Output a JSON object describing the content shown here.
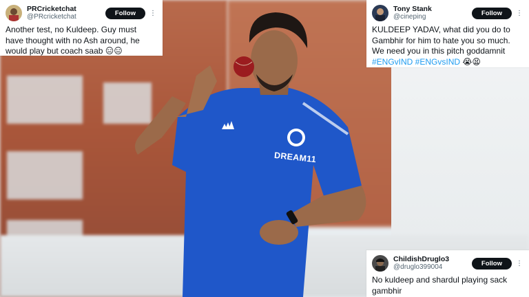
{
  "tweets": [
    {
      "display_name": "PRCricketchat",
      "handle": "@PRcricketchat",
      "follow_label": "Follow",
      "more_icon": "⋮",
      "text": "Another test, no Kuldeep. Guy must have thought with no Ash around, he would play but coach saab",
      "emojis": "😑😑"
    },
    {
      "display_name": "Tony Stank",
      "handle": "@cineping",
      "follow_label": "Follow",
      "more_icon": "⋮",
      "text": "KULDEEP YADAV, what did you do to Gambhir for him to hate you so much. We need you in this pitch goddamnit ",
      "hashtags": "#ENGvIND #ENGvsIND",
      "emojis": "😭😫"
    },
    {
      "display_name": "ChildishDruglo3",
      "handle": "@druglo399004",
      "follow_label": "Follow",
      "more_icon": "⋮",
      "text": "No kuldeep and shardul playing sack gambhir"
    }
  ],
  "jersey": {
    "sponsor": "DREAM11"
  },
  "colors": {
    "jersey_blue": "#1f57c9",
    "follow_bg": "#0f1419",
    "hashtag": "#1d9bf0"
  }
}
